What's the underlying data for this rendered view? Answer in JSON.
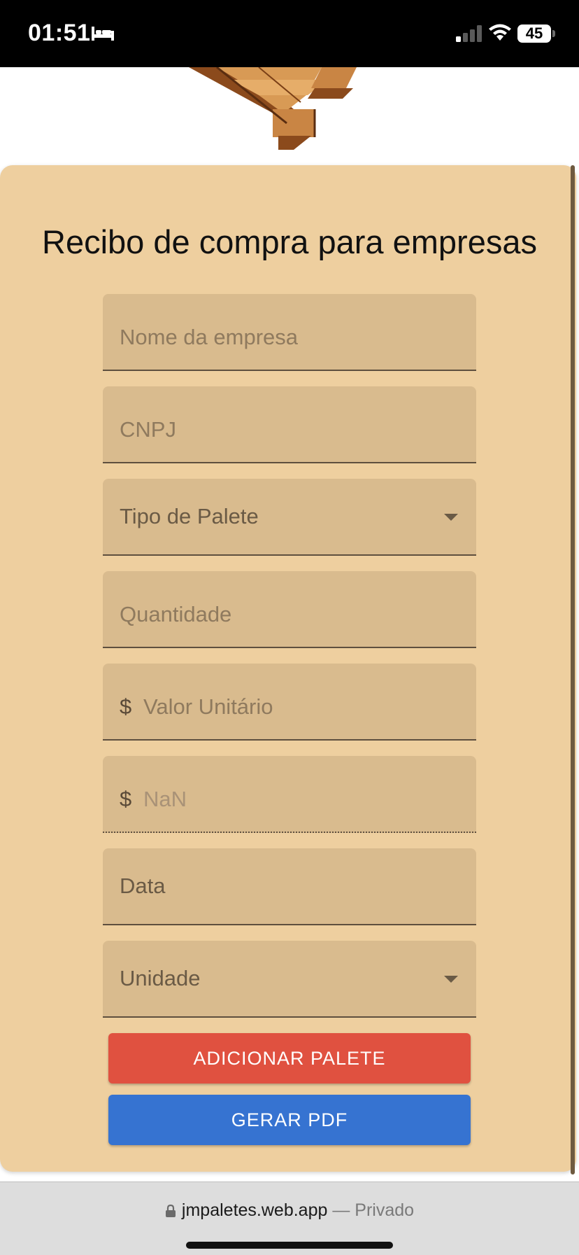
{
  "status_bar": {
    "time": "01:51",
    "battery": "45",
    "icons": [
      "bed-icon",
      "signal-icon",
      "wifi-icon",
      "battery-icon"
    ]
  },
  "form": {
    "title": "Recibo de compra para empresas",
    "fields": {
      "company_name": {
        "placeholder": "Nome da empresa",
        "value": ""
      },
      "cnpj": {
        "placeholder": "CNPJ",
        "value": ""
      },
      "pallet_type": {
        "label": "Tipo de Palete",
        "icon": "chevron-down-icon"
      },
      "quantity": {
        "placeholder": "Quantidade",
        "value": ""
      },
      "unit_value": {
        "prefix": "$",
        "placeholder": "Valor Unitário",
        "value": ""
      },
      "total": {
        "prefix": "$",
        "value": "NaN"
      },
      "date": {
        "label": "Data"
      },
      "unit": {
        "label": "Unidade",
        "icon": "chevron-down-icon"
      }
    },
    "buttons": {
      "add_pallet": "ADICIONAR PALETE",
      "generate_pdf": "GERAR PDF"
    }
  },
  "browser": {
    "domain": "jmpaletes.web.app",
    "separator": " — ",
    "privacy": "Privado"
  },
  "colors": {
    "card_background": "#eecf9f",
    "field_background": "#d9bb8e",
    "add_button": "#e05140",
    "pdf_button": "#3673d1"
  }
}
